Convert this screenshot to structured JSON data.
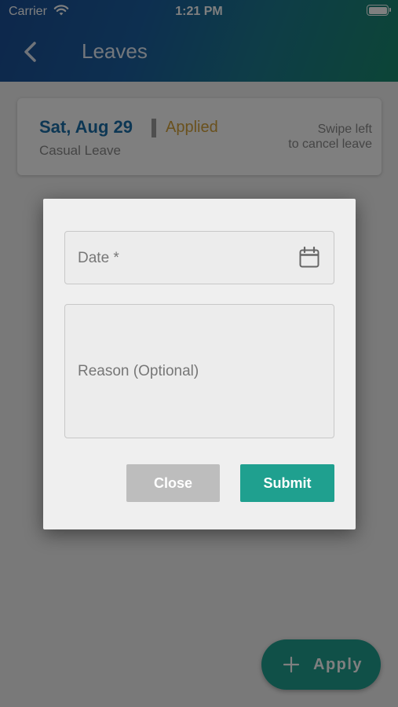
{
  "status_bar": {
    "carrier": "Carrier",
    "time": "1:21 PM",
    "wifi_icon": "wifi-icon",
    "battery_icon": "battery-icon"
  },
  "header": {
    "title": "Leaves",
    "back_icon": "chevron-left-icon",
    "gradient_colors": [
      "#1a4f97",
      "#198a6e"
    ]
  },
  "leave_card": {
    "date": "Sat, Aug 29",
    "status": "Applied",
    "status_color": "#d4a23a",
    "leave_type": "Casual Leave",
    "hint_line1": "Swipe left",
    "hint_line2": "to cancel leave"
  },
  "dialog": {
    "date_placeholder": "Date *",
    "calendar_icon": "calendar-icon",
    "reason_placeholder": "Reason (Optional)",
    "close_label": "Close",
    "submit_label": "Submit",
    "submit_color": "#1fa08f"
  },
  "fab": {
    "label": "Apply",
    "icon": "plus-icon",
    "color": "#20a090"
  }
}
